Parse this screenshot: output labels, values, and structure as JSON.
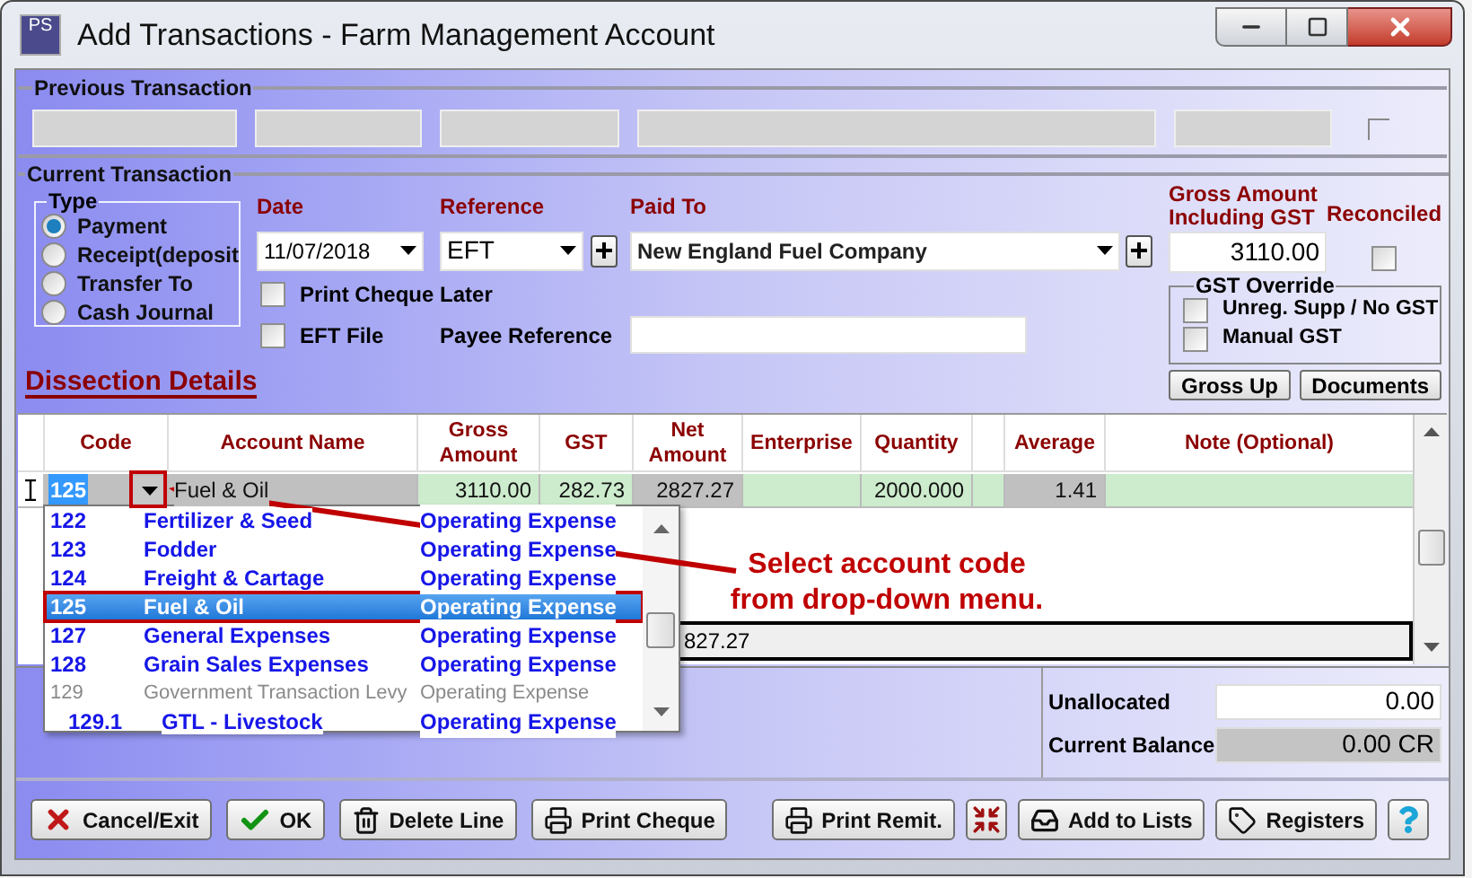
{
  "window": {
    "title": "Add Transactions - Farm Management Account",
    "icon_label": "PS"
  },
  "previous_transaction": {
    "title": "Previous Transaction",
    "checkbox": {
      "checked": false
    }
  },
  "current_transaction": {
    "title": "Current Transaction",
    "type": {
      "title": "Type",
      "options": [
        {
          "label": "Payment",
          "selected": true
        },
        {
          "label": "Receipt(deposit",
          "selected": false
        },
        {
          "label": "Transfer To",
          "selected": false
        },
        {
          "label": "Cash Journal",
          "selected": false
        }
      ]
    },
    "date": {
      "label": "Date",
      "value": "11/07/2018"
    },
    "reference": {
      "label": "Reference",
      "value": "EFT"
    },
    "paid_to": {
      "label": "Paid To",
      "value": "New England Fuel Company"
    },
    "gross_amount": {
      "label": "Gross Amount Including GST",
      "value": "3110.00"
    },
    "reconciled": {
      "label": "Reconciled",
      "checked": false
    },
    "print_cheque_later": {
      "label": "Print Cheque Later",
      "checked": false
    },
    "eft_file": {
      "label": "EFT File",
      "checked": false
    },
    "payee_reference": {
      "label": "Payee Reference"
    },
    "gst_override": {
      "title": "GST Override",
      "options": [
        {
          "label": "Unreg. Supp / No GST",
          "checked": false
        },
        {
          "label": "Manual GST",
          "checked": false
        }
      ]
    },
    "buttons": [
      "Gross Up",
      "Documents"
    ]
  },
  "dissection": {
    "title": "Dissection Details",
    "columns": [
      {
        "label": "Code",
        "kind": "code"
      },
      {
        "label": "Account Name",
        "kind": "calc"
      },
      {
        "label": "Gross Amount",
        "kind": "input"
      },
      {
        "label": "GST",
        "kind": "input"
      },
      {
        "label": "Net Amount",
        "kind": "calc"
      },
      {
        "label": "Enterprise",
        "kind": "input"
      },
      {
        "label": "Quantity",
        "kind": "input"
      },
      {
        "kind": "input"
      },
      {
        "label": "Average",
        "kind": "calc"
      },
      {
        "label": "Note (Optional)",
        "kind": "input"
      }
    ],
    "rows": [
      {
        "cells": [
          "125",
          "Fuel & Oil",
          "3110.00",
          "282.73",
          "2827.27",
          null,
          "2000.000",
          null,
          "1.41",
          null
        ]
      }
    ],
    "totals": {
      "net_amount": "827.27"
    }
  },
  "account_list": {
    "items": [
      {
        "code": "122",
        "name": "Fertilizer & Seed",
        "type": "Operating Expense",
        "selected": false,
        "disabled": false
      },
      {
        "code": "123",
        "name": "Fodder",
        "type": "Operating Expense",
        "selected": false,
        "disabled": false
      },
      {
        "code": "124",
        "name": "Freight & Cartage",
        "type": "Operating Expense",
        "selected": false,
        "disabled": false
      },
      {
        "code": "125",
        "name": "Fuel & Oil",
        "type": "Operating Expense",
        "selected": true,
        "disabled": false
      },
      {
        "code": "127",
        "name": "General Expenses",
        "type": "Operating Expense",
        "selected": false,
        "disabled": false
      },
      {
        "code": "128",
        "name": "Grain Sales Expenses",
        "type": "Operating Expense",
        "selected": false,
        "disabled": false
      },
      {
        "code": "129",
        "name": "Government Transaction Levy",
        "type": "Operating Expense",
        "selected": false,
        "disabled": true,
        "children": [
          {
            "code": "129.1",
            "name": "GTL - Livestock",
            "type": "Operating Expense",
            "selected": false,
            "disabled": false
          }
        ]
      }
    ]
  },
  "annotation": {
    "text": "Select account code from drop-down menu."
  },
  "summary": {
    "unallocated": {
      "label": "Unallocated",
      "value": "0.00"
    },
    "current_balance": {
      "label": "Current Balance",
      "value": "0.00 CR"
    }
  },
  "buttons_left": [
    {
      "label": "Cancel/Exit",
      "kind": "cancel"
    },
    {
      "label": "OK",
      "kind": "ok"
    },
    {
      "label": "Delete Line",
      "kind": "delete"
    },
    {
      "label": "Print Cheque",
      "kind": "print"
    }
  ],
  "buttons_right": [
    {
      "label": "Print Remit.",
      "kind": "print"
    },
    {
      "kind": "shrink"
    },
    {
      "label": "Add to Lists",
      "kind": "add"
    },
    {
      "label": "Registers",
      "kind": "registers"
    },
    {
      "kind": "help"
    }
  ]
}
